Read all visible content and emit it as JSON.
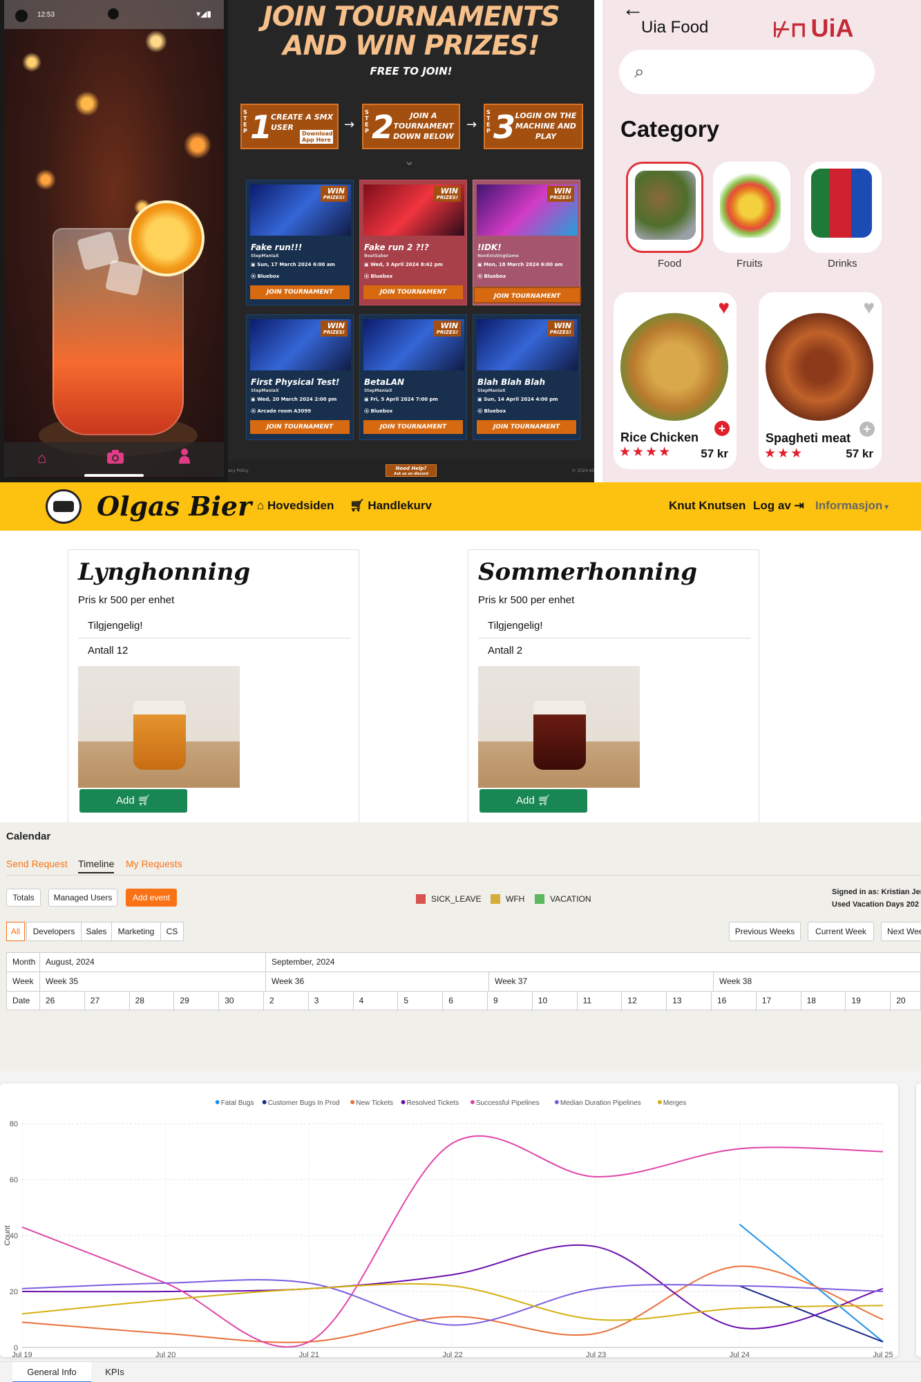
{
  "phone": {
    "status_time": "12:53",
    "nav_icons": [
      "home-icon",
      "camera-icon",
      "person-icon"
    ],
    "accent_color": "#e03c86"
  },
  "tournament": {
    "headline_1": "JOIN TOURNAMENTS",
    "headline_2": "AND WIN PRIZES!",
    "free": "FREE TO JOIN!",
    "step_word": "STEP",
    "steps": [
      {
        "num": "1",
        "text": "CREATE A SMX USER",
        "extra": "Download App Here"
      },
      {
        "num": "2",
        "text": "JOIN A TOURNAMENT DOWN BELOW"
      },
      {
        "num": "3",
        "text": "LOGIN ON THE MACHINE AND PLAY"
      }
    ],
    "win_label": "WIN",
    "prizes_label": "PRIZES!",
    "join_label": "JOIN TOURNAMENT",
    "cards": [
      {
        "title": "Fake run!!!",
        "organizer": "StepManiaX",
        "date": "Sun, 17 March 2024 6:00 am",
        "location": "Bluebox"
      },
      {
        "title": "Fake run 2 ?!?",
        "organizer": "BeatSaber",
        "date": "Wed, 3 April 2024 8:42 pm",
        "location": "Bluebox"
      },
      {
        "title": "!IDK!",
        "organizer": "NonExistingGame",
        "date": "Mon, 18 March 2024 6:00 am",
        "location": "Bluebox"
      },
      {
        "title": "First Physical Test!",
        "organizer": "StepManiaX",
        "date": "Wed, 20 March 2024 2:00 pm",
        "location": "Arcade room A3099"
      },
      {
        "title": "BetaLAN",
        "organizer": "StepManiaX",
        "date": "Fri, 5 April 2024 7:00 pm",
        "location": "Bluebox"
      },
      {
        "title": "Blah Blah Blah",
        "organizer": "StepManiaX",
        "date": "Sun, 14 April 2024 4:00 pm",
        "location": "Bluebox"
      }
    ],
    "footer_left": "acy Policy",
    "help": "Need Help?",
    "help_sub": "Ask us on discord",
    "footer_right": "© 2024 All"
  },
  "food": {
    "title": "Uia Food",
    "logo": "UiA",
    "category_heading": "Category",
    "categories": [
      "Food",
      "Fruits",
      "Drinks"
    ],
    "products": [
      {
        "name": "Rice Chicken",
        "price": "57 kr",
        "stars": "★★★★",
        "favorite": true
      },
      {
        "name": "Spagheti meat",
        "price": "57 kr",
        "stars": "★★★",
        "favorite": false
      }
    ],
    "accent_color": "#e0202c"
  },
  "bier": {
    "brand": "Olgas Bier",
    "nav": {
      "home": "Hovedsiden",
      "cart": "Handlekurv",
      "user": "Knut Knutsen",
      "logout": "Log av",
      "info": "Informasjon"
    },
    "products": [
      {
        "name": "Lynghonning",
        "price": "Pris kr 500 per enhet",
        "availability": "Tilgjengelig!",
        "count": "Antall 12",
        "add": "Add"
      },
      {
        "name": "Sommerhonning",
        "price": "Pris kr 500 per enhet",
        "availability": "Tilgjengelig!",
        "count": "Antall 2",
        "add": "Add"
      }
    ],
    "nav_color": "#fcc20f",
    "button_color": "#198754"
  },
  "calendar": {
    "title": "Calendar",
    "tabs": [
      "Send Request",
      "Timeline",
      "My Requests"
    ],
    "active_tab": "Timeline",
    "buttons": {
      "totals": "Totals",
      "managed": "Managed Users",
      "add_event": "Add event"
    },
    "legend": [
      {
        "label": "SICK_LEAVE",
        "color": "#d9534f"
      },
      {
        "label": "WFH",
        "color": "#d4ad3a"
      },
      {
        "label": "VACATION",
        "color": "#5cb85c"
      }
    ],
    "signed_in": "Signed in as: Kristian Jen",
    "vacation_days": "Used Vacation Days 202",
    "groups": [
      "All",
      "Developers",
      "Sales",
      "Marketing",
      "CS"
    ],
    "active_group": "All",
    "week_buttons": [
      "Previous Weeks",
      "Current Week",
      "Next Wee"
    ],
    "row_labels": [
      "Month",
      "Week",
      "Date"
    ],
    "months": [
      "August, 2024",
      "September, 2024"
    ],
    "weeks": [
      "Week 35",
      "Week 36",
      "Week 37",
      "Week 38"
    ],
    "dates": [
      "26",
      "27",
      "28",
      "29",
      "30",
      "2",
      "3",
      "4",
      "5",
      "6",
      "9",
      "10",
      "11",
      "12",
      "13",
      "16",
      "17",
      "18",
      "19",
      "20"
    ]
  },
  "kpi": {
    "tabs": [
      "General Info",
      "KPIs"
    ],
    "active_tab": "General Info"
  },
  "chart_data": {
    "type": "line",
    "title": "",
    "xlabel": "Date",
    "ylabel": "Count",
    "x": [
      "Jul 19",
      "Jul 20",
      "Jul 21",
      "Jul 22",
      "Jul 23",
      "Jul 24",
      "Jul 25"
    ],
    "ylim": [
      0,
      80
    ],
    "yticks": [
      0,
      20,
      40,
      60,
      80
    ],
    "grid": true,
    "legend_position": "top-center",
    "series": [
      {
        "name": "Fatal Bugs",
        "color": "#1e90e6",
        "values": [
          null,
          null,
          null,
          null,
          null,
          44,
          2
        ]
      },
      {
        "name": "Customer Bugs In Prod",
        "color": "#1c2a8a",
        "values": [
          null,
          null,
          null,
          null,
          null,
          22,
          2
        ]
      },
      {
        "name": "New Tickets",
        "color": "#e9703a",
        "values": [
          9,
          5,
          2,
          11,
          5,
          29,
          10
        ]
      },
      {
        "name": "Resolved Tickets",
        "color": "#6a0dad",
        "values": [
          20,
          20,
          21,
          26,
          36,
          7,
          21
        ]
      },
      {
        "name": "Successful Pipelines",
        "color": "#e044a8",
        "values": [
          43,
          23,
          2,
          73,
          61,
          71,
          70
        ]
      },
      {
        "name": "Median Duration Pipelines",
        "color": "#7b5ce0",
        "values": [
          21,
          23,
          23,
          8,
          21,
          22,
          20
        ]
      },
      {
        "name": "Merges",
        "color": "#d4b010",
        "values": [
          12,
          17,
          21,
          22,
          10,
          14,
          15
        ]
      }
    ]
  }
}
